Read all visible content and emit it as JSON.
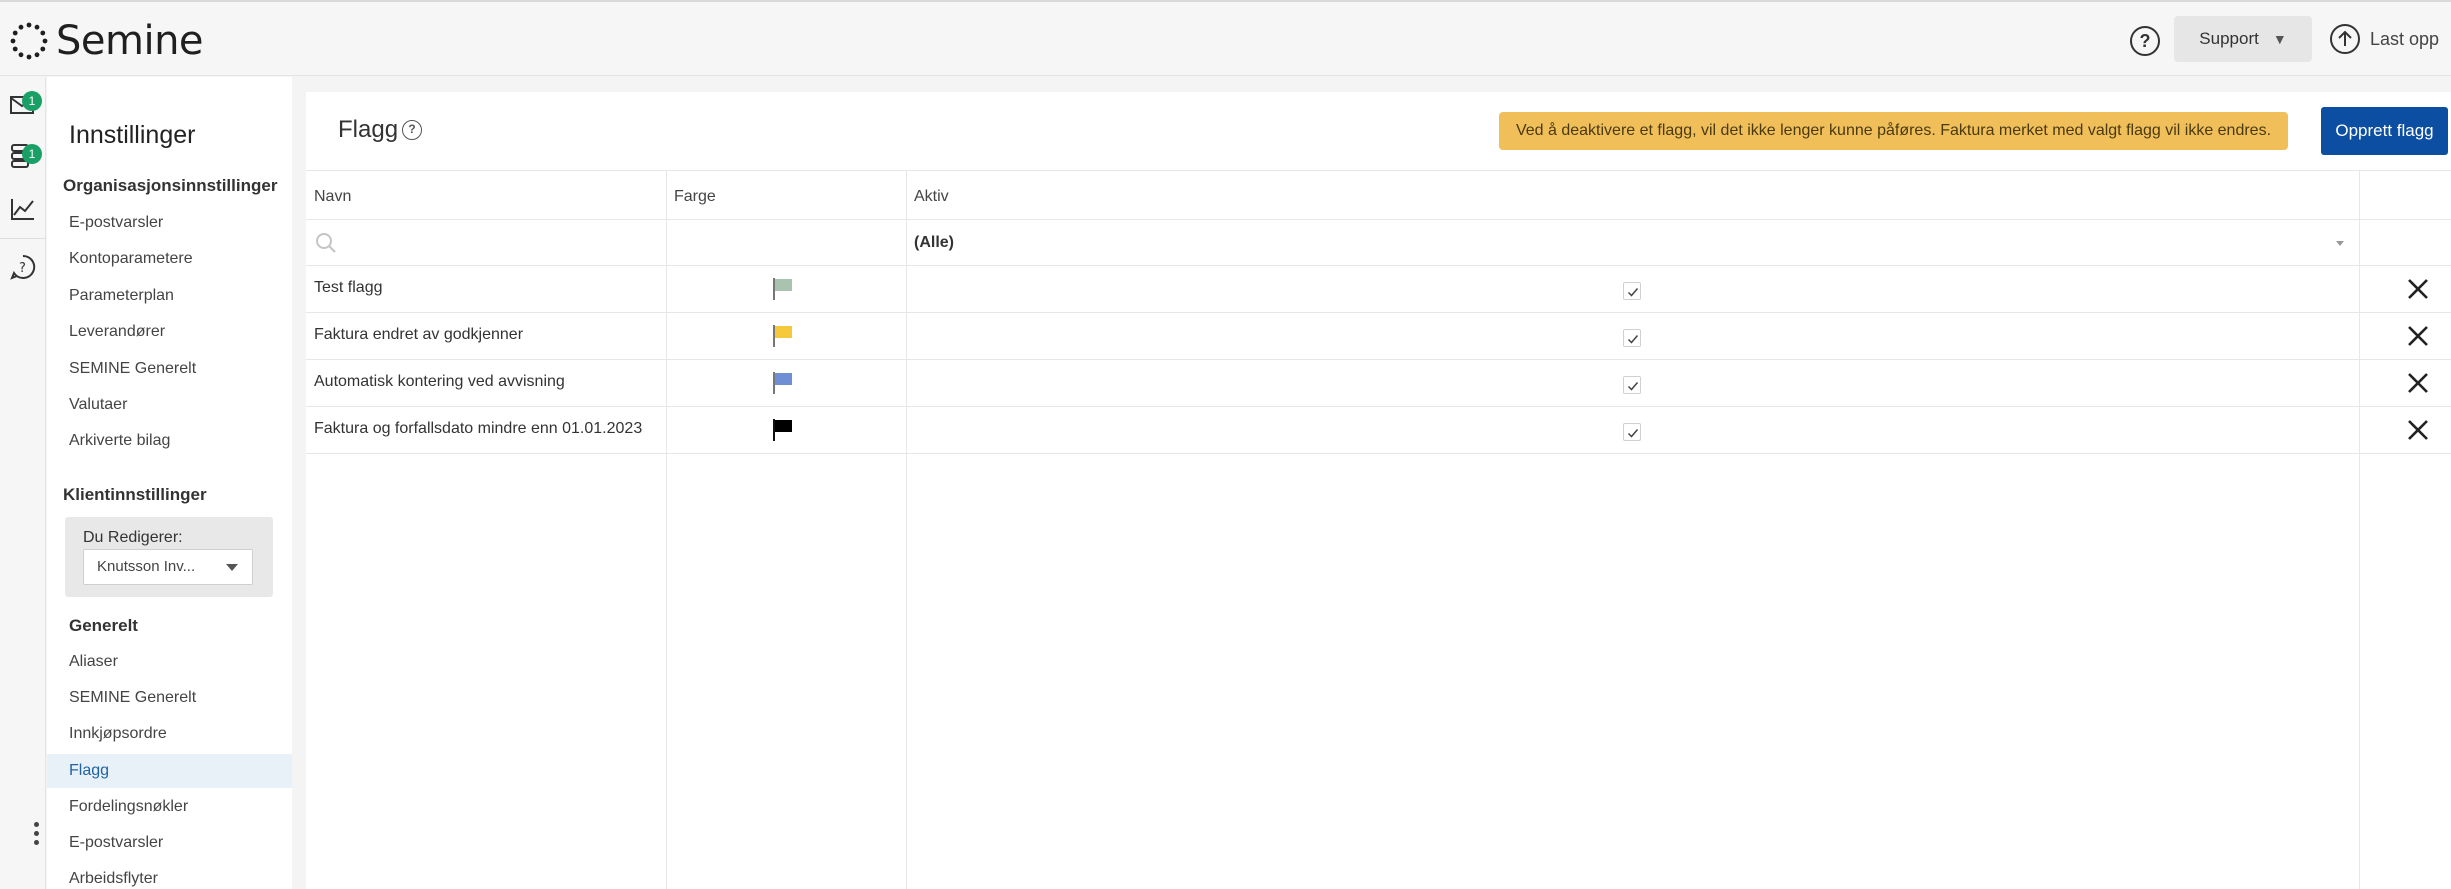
{
  "brand": {
    "name": "Semine"
  },
  "topbar": {
    "help": "?",
    "support": "Support",
    "upload": "Last opp"
  },
  "rail": {
    "badges": [
      "1",
      "1"
    ]
  },
  "sidebar": {
    "title": "Innstillinger",
    "org_section": "Organisasjonsinnstillinger",
    "org_items": [
      "E-postvarsler",
      "Kontoparametere",
      "Parameterplan",
      "Leverandører",
      "SEMINE Generelt",
      "Valutaer",
      "Arkiverte bilag"
    ],
    "client_section": "Klientinnstillinger",
    "editor_label": "Du Redigerer:",
    "editor_value": "Knutsson Inv...",
    "general_section": "Generelt",
    "general_items": [
      "Aliaser",
      "SEMINE Generelt",
      "Innkjøpsordre",
      "Flagg",
      "Fordelingsnøkler",
      "E-postvarsler",
      "Arbeidsflyter"
    ]
  },
  "main": {
    "title": "Flagg",
    "help": "?",
    "warning": "Ved å deaktivere et flagg, vil det ikke lenger kunne påføres. Faktura merket med valgt flagg vil ikke endres.",
    "create_button": "Opprett flagg"
  },
  "table": {
    "headers": [
      "Navn",
      "Farge",
      "Aktiv"
    ],
    "filter_active": "(Alle)",
    "rows": [
      {
        "name": "Test flagg",
        "color": "#a9c3ae",
        "active": true
      },
      {
        "name": "Faktura endret av godkjenner",
        "color": "#f5c93a",
        "active": true
      },
      {
        "name": "Automatisk kontering ved avvisning",
        "color": "#6f8fd4",
        "active": true
      },
      {
        "name": "Faktura og forfallsdato mindre enn 01.01.2023",
        "color": "#000000",
        "active": true
      }
    ]
  },
  "colors": {
    "accent": "#0b4ea2",
    "warning": "#f1bf5a",
    "badge": "#1aa067",
    "active_nav": "#1e63a5"
  }
}
